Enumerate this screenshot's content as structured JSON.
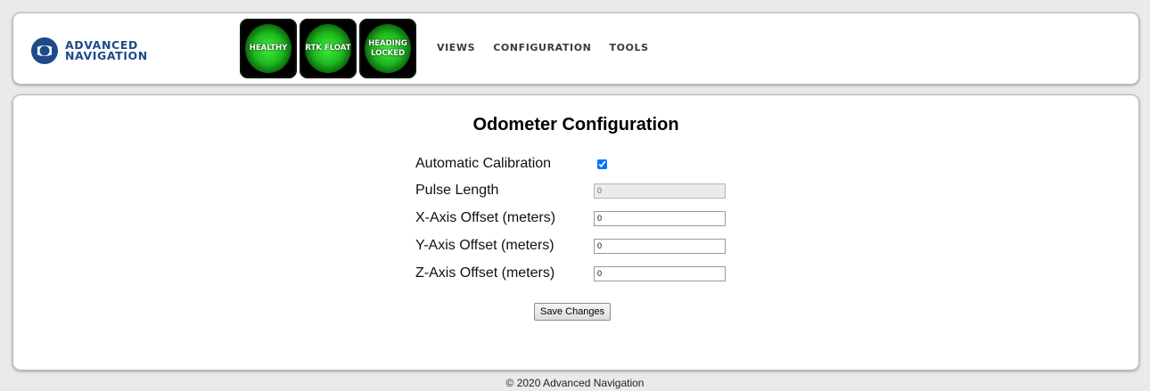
{
  "header": {
    "logo_line1": "ADVANCED",
    "logo_line2": "NAVIGATION",
    "logo_icon": "advanced-navigation-logo-icon",
    "status_tiles": [
      {
        "line1": "HEALTHY",
        "line2": "",
        "color": "#22c422"
      },
      {
        "line1": "RTK FLOAT",
        "line2": "",
        "color": "#22c422"
      },
      {
        "line1": "HEADING",
        "line2": "LOCKED",
        "color": "#22c422"
      }
    ],
    "nav": [
      "VIEWS",
      "CONFIGURATION",
      "TOOLS"
    ]
  },
  "form": {
    "title": "Odometer Configuration",
    "automatic_calibration": {
      "label": "Automatic Calibration",
      "checked": true
    },
    "pulse_length": {
      "label": "Pulse Length",
      "value": "0",
      "disabled": true
    },
    "x_offset": {
      "label": "X-Axis Offset (meters)",
      "value": "0"
    },
    "y_offset": {
      "label": "Y-Axis Offset (meters)",
      "value": "0"
    },
    "z_offset": {
      "label": "Z-Axis Offset (meters)",
      "value": "0"
    },
    "save_label": "Save Changes"
  },
  "footer": {
    "text": "© 2020 Advanced Navigation"
  },
  "colors": {
    "brand": "#1d4a8a",
    "status_ok": "#22c422"
  }
}
